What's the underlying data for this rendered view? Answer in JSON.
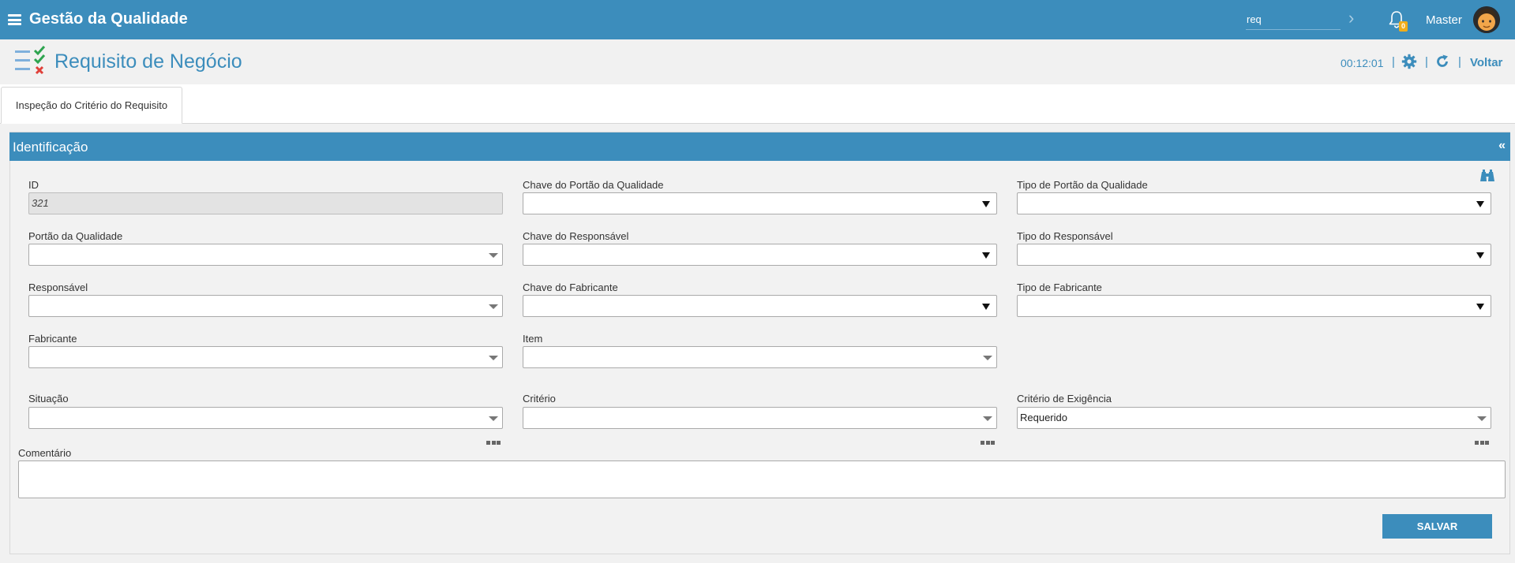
{
  "app": {
    "title": "Gestão da Qualidade",
    "search_value": "req",
    "notification_count": "0",
    "user_name": "Master"
  },
  "page": {
    "title": "Requisito de Negócio",
    "timer": "00:12:01",
    "separator": "|",
    "back_label": "Voltar"
  },
  "tabs": [
    {
      "label": "Inspeção do Critério do Requisito"
    }
  ],
  "section": {
    "title": "Identificação",
    "collapse_glyph": "«"
  },
  "form": {
    "id": {
      "label": "ID",
      "value": "321"
    },
    "chave_portao": {
      "label": "Chave do Portão da Qualidade",
      "value": ""
    },
    "tipo_portao": {
      "label": "Tipo de Portão da Qualidade",
      "value": ""
    },
    "portao": {
      "label": "Portão da Qualidade",
      "value": ""
    },
    "chave_responsavel": {
      "label": "Chave do Responsável",
      "value": ""
    },
    "tipo_responsavel": {
      "label": "Tipo do Responsável",
      "value": ""
    },
    "responsavel": {
      "label": "Responsável",
      "value": ""
    },
    "chave_fabricante": {
      "label": "Chave do Fabricante",
      "value": ""
    },
    "tipo_fabricante": {
      "label": "Tipo de Fabricante",
      "value": ""
    },
    "fabricante": {
      "label": "Fabricante",
      "value": ""
    },
    "item": {
      "label": "Item",
      "value": ""
    },
    "situacao": {
      "label": "Situação",
      "value": ""
    },
    "criterio": {
      "label": "Critério",
      "value": ""
    },
    "criterio_exigencia": {
      "label": "Critério de Exigência",
      "value": "Requerido"
    },
    "comentario": {
      "label": "Comentário",
      "value": ""
    },
    "save_label": "SALVAR"
  },
  "colors": {
    "brand": "#3c8dbc",
    "badge": "#f0ad1a",
    "check": "#2ea44f",
    "cross": "#e0403a"
  }
}
